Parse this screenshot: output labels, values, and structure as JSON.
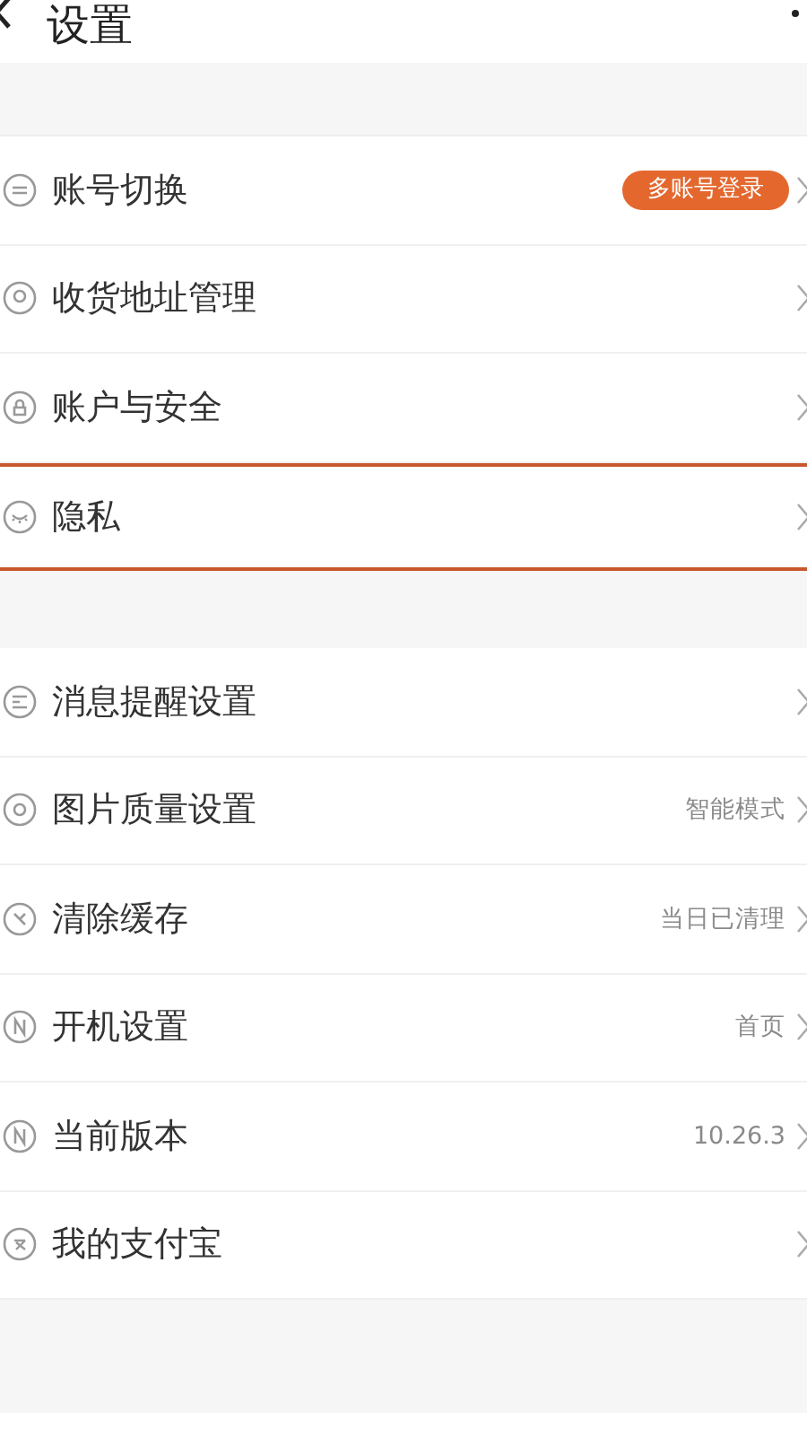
{
  "header": {
    "title": "设置"
  },
  "groups": [
    {
      "items": [
        {
          "label": "账号切换",
          "badge": "多账号登录",
          "highlighted": false
        },
        {
          "label": "收货地址管理",
          "highlighted": false
        },
        {
          "label": "账户与安全",
          "highlighted": false
        },
        {
          "label": "隐私",
          "highlighted": true
        }
      ]
    },
    {
      "items": [
        {
          "label": "消息提醒设置",
          "highlighted": false
        },
        {
          "label": "图片质量设置",
          "value": "智能模式",
          "highlighted": false
        },
        {
          "label": "清除缓存",
          "value": "当日已清理",
          "highlighted": false
        },
        {
          "label": "开机设置",
          "value": "首页",
          "highlighted": false
        },
        {
          "label": "当前版本",
          "value": "10.26.3",
          "highlighted": false
        },
        {
          "label": "我的支付宝",
          "highlighted": false
        }
      ]
    }
  ]
}
